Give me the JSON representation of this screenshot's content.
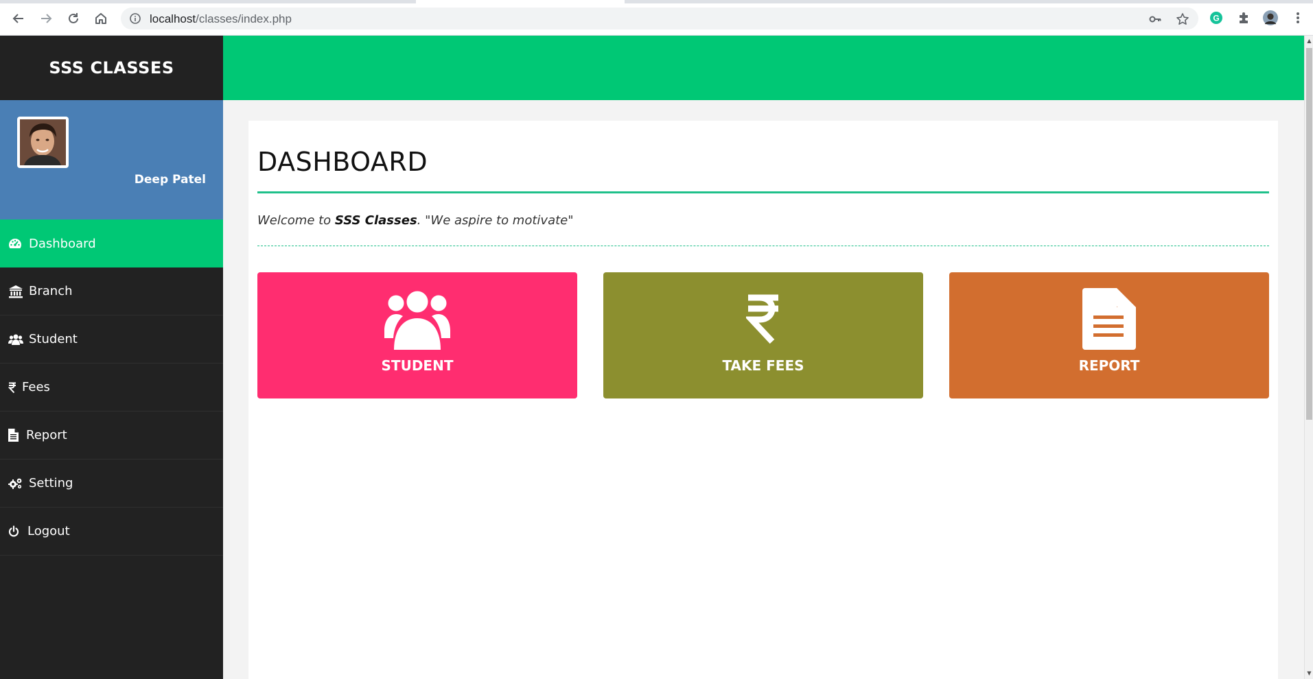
{
  "browser": {
    "url_host": "localhost",
    "url_path": "/classes/index.php"
  },
  "sidebar": {
    "brand": "SSS CLASSES",
    "user_name": "Deep Patel",
    "items": [
      {
        "label": "Dashboard",
        "icon": "tachometer-icon",
        "active": true
      },
      {
        "label": "Branch",
        "icon": "bank-icon"
      },
      {
        "label": "Student",
        "icon": "users-icon"
      },
      {
        "label": "Fees",
        "icon": "rupee-icon"
      },
      {
        "label": "Report",
        "icon": "file-text-icon"
      },
      {
        "label": "Setting",
        "icon": "gears-icon"
      },
      {
        "label": "Logout",
        "icon": "power-icon"
      }
    ]
  },
  "main": {
    "title": "DASHBOARD",
    "welcome_prefix": "Welcome to ",
    "welcome_brand": "SSS Classes",
    "welcome_suffix": ". \"We aspire to motivate\"",
    "tiles": [
      {
        "label": "STUDENT",
        "icon": "users-icon",
        "color": "#ff2d70"
      },
      {
        "label": "TAKE FEES",
        "icon": "rupee-icon",
        "color": "#8c8f2f"
      },
      {
        "label": "REPORT",
        "icon": "file-text-icon",
        "color": "#d26e2f"
      }
    ]
  },
  "colors": {
    "accent_green": "#00c875",
    "sidebar_bg": "#222222",
    "profile_bg": "#4a7fb5"
  }
}
